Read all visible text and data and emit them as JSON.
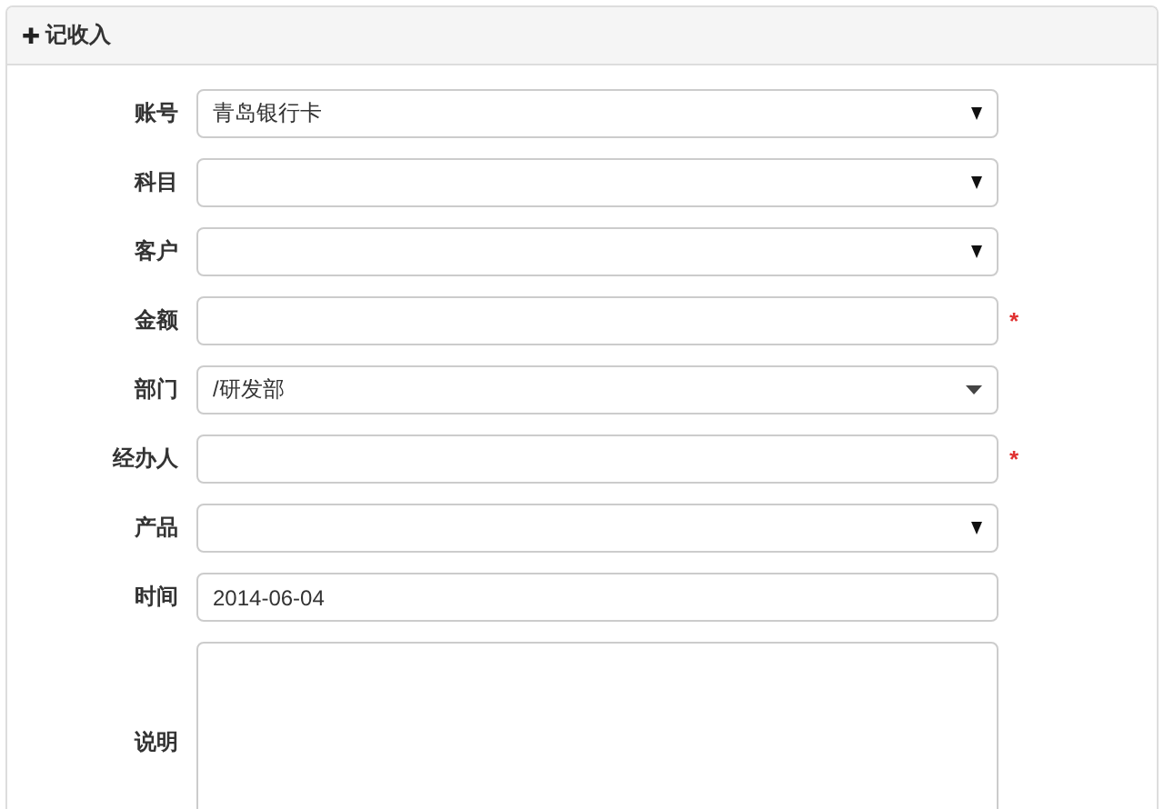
{
  "panel": {
    "icon": "✚",
    "title": "记收入"
  },
  "fields": [
    {
      "label": "账号",
      "kind": "select",
      "value": "青岛银行卡",
      "required": false
    },
    {
      "label": "科目",
      "kind": "select",
      "required": false
    },
    {
      "label": "客户",
      "kind": "select",
      "required": false
    },
    {
      "label": "金额",
      "kind": "input",
      "required": true
    },
    {
      "label": "部门",
      "kind": "combo",
      "value": "/研发部",
      "required": false
    },
    {
      "label": "经办人",
      "kind": "input",
      "required": true
    },
    {
      "label": "产品",
      "kind": "select",
      "required": false
    },
    {
      "label": "时间",
      "kind": "input",
      "value": "2014-06-04",
      "required": false
    },
    {
      "label": "说明",
      "kind": "textarea",
      "required": false
    }
  ],
  "required_mark": "*"
}
